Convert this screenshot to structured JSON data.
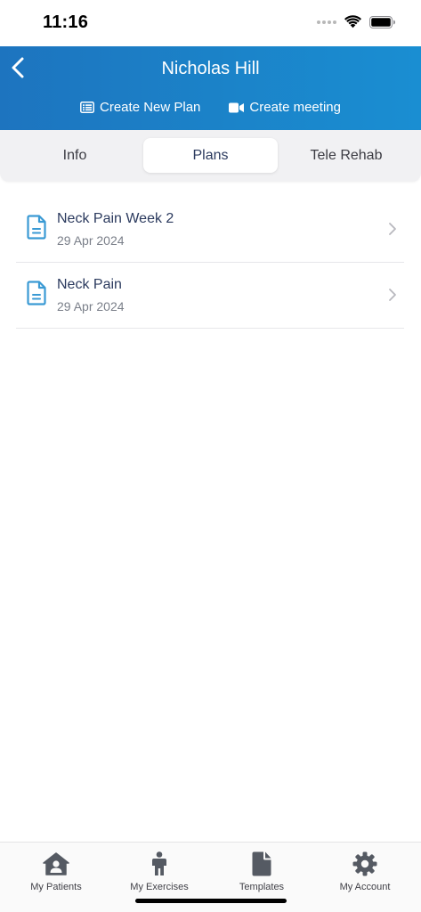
{
  "status_bar": {
    "time": "11:16"
  },
  "header": {
    "title": "Nicholas Hill",
    "actions": [
      {
        "label": "Create New Plan",
        "icon": "list-alt-icon"
      },
      {
        "label": "Create meeting",
        "icon": "video-camera-icon"
      }
    ]
  },
  "tabs": [
    {
      "label": "Info",
      "selected": false
    },
    {
      "label": "Plans",
      "selected": true
    },
    {
      "label": "Tele Rehab",
      "selected": false
    }
  ],
  "plans": [
    {
      "title": "Neck Pain Week 2",
      "date": "29 Apr 2024",
      "icon": "document-icon"
    },
    {
      "title": "Neck Pain",
      "date": "29 Apr 2024",
      "icon": "document-icon"
    }
  ],
  "tab_bar": [
    {
      "label": "My Patients",
      "icon": "house-user-icon"
    },
    {
      "label": "My Exercises",
      "icon": "person-icon"
    },
    {
      "label": "Templates",
      "icon": "file-icon"
    },
    {
      "label": "My Account",
      "icon": "gear-icon"
    }
  ],
  "colors": {
    "header_start": "#1d74bf",
    "header_end": "#1a8ed2",
    "plan_icon": "#3a9ad4",
    "text_primary": "#2b3a5e"
  }
}
